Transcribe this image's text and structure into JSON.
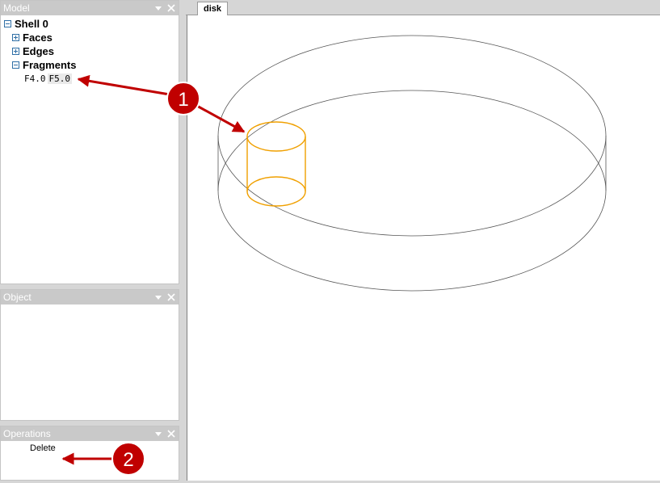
{
  "panels": {
    "model": {
      "title": "Model"
    },
    "object": {
      "title": "Object"
    },
    "operations": {
      "title": "Operations",
      "delete_label": "Delete"
    }
  },
  "tree": {
    "root": "Shell 0",
    "children": [
      "Faces",
      "Edges",
      "Fragments"
    ],
    "fragments": [
      "F4.0",
      "F5.0"
    ]
  },
  "viewport": {
    "tab_label": "disk"
  },
  "callouts": [
    "1",
    "2"
  ],
  "colors": {
    "selection": "#f0a000",
    "callout": "#c00000",
    "header": "#c9c9c9",
    "wireframe": "#555555"
  }
}
